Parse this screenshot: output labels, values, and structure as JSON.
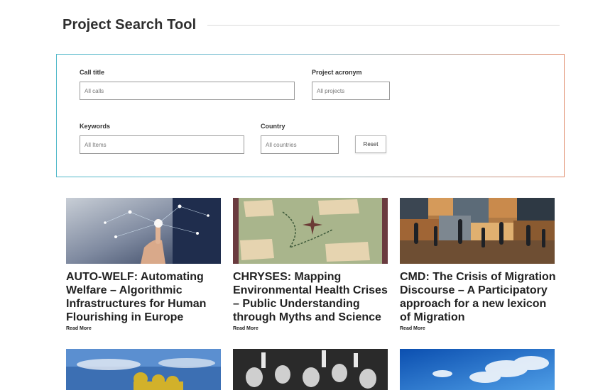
{
  "page": {
    "title": "Project Search Tool"
  },
  "search": {
    "call_title_label": "Call title",
    "call_title_placeholder": "All calls",
    "acronym_label": "Project acronym",
    "acronym_placeholder": "All projects",
    "keywords_label": "Keywords",
    "keywords_placeholder": "All Items",
    "country_label": "Country",
    "country_placeholder": "All countries",
    "reset_label": "Reset"
  },
  "projects": [
    {
      "title": "AUTO-WELF: Automating Welfare – Algorithmic Infrastructures for Human Flourishing in Europe",
      "link": "Read More"
    },
    {
      "title": "CHRYSES: Mapping Environmental Health Crises – Public Understanding through Myths and Science",
      "link": "Read More"
    },
    {
      "title": "CMD: The Crisis of Migration Discourse – A Participatory approach for a new lexicon of Migration",
      "link": "Read More"
    }
  ],
  "colors": {
    "panel_border_start": "#4fb8c9",
    "panel_border_end": "#e08a6a"
  }
}
